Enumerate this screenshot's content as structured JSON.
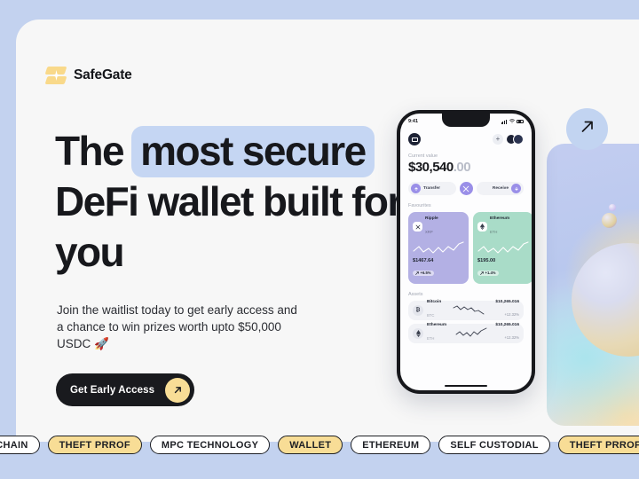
{
  "brand": {
    "name": "SafeGate",
    "logo_icon": "sparkle-stack-icon",
    "logo_color": "#f9d98a"
  },
  "hero": {
    "headline_part1": "The ",
    "headline_highlight": "most secure",
    "headline_part2": " DeFi wallet built for you",
    "highlight_color": "#c5d6f3",
    "subtext": "Join the waitlist today to get early access and a chance to win prizes worth upto $50,000 USDC 🚀",
    "cta_label": "Get Early Access",
    "cta_icon": "arrow-up-right-icon",
    "cta_bg": "#191a1e",
    "cta_icon_bg": "#f8dd96"
  },
  "badge": {
    "icon": "arrow-up-right-icon",
    "bg": "#c2d4f1"
  },
  "phone": {
    "status": {
      "time": "9:41",
      "signal_icon": "signal-bars-icon",
      "wifi_icon": "wifi-icon",
      "battery_icon": "battery-icon"
    },
    "topbar": {
      "menu_icon": "card-menu-icon",
      "add_icon": "plus-icon",
      "avatars_icon": "avatar-group-icon"
    },
    "balance": {
      "label": "Current value",
      "whole": "$30,540",
      "decimals": ".00"
    },
    "actions": [
      {
        "label": "Transfer",
        "icon": "arrow-up-icon"
      },
      {
        "label": "",
        "icon": "swap-icon"
      },
      {
        "label": "Receive",
        "icon": "arrow-down-icon"
      }
    ],
    "favourites_label": "Favourites",
    "favourites": [
      {
        "name": "Ripple",
        "symbol": "XRP",
        "value": "$1467.64",
        "change": "+6.5%",
        "icon": "xrp-icon",
        "bg": "#b3b0e4"
      },
      {
        "name": "Ethereum",
        "symbol": "ETH",
        "value": "$195.00",
        "change": "+1.4%",
        "icon": "eth-icon",
        "bg": "#a9dcc8"
      }
    ],
    "assets_label": "Assets",
    "assets": [
      {
        "name": "Bitcoin",
        "symbol": "BTC",
        "value": "$10,265.016",
        "change": "+12.32%",
        "icon": "btc-icon"
      },
      {
        "name": "Ethereum",
        "symbol": "ETH",
        "value": "$10,265.016",
        "change": "+12.32%",
        "icon": "eth-icon"
      }
    ]
  },
  "tags": [
    {
      "label": "MULTICHAIN",
      "highlight": false
    },
    {
      "label": "THEFT PRROF",
      "highlight": true
    },
    {
      "label": "MPC TECHNOLOGY",
      "highlight": false
    },
    {
      "label": "WALLET",
      "highlight": true
    },
    {
      "label": "ETHEREUM",
      "highlight": false
    },
    {
      "label": "SELF CUSTODIAL",
      "highlight": false
    },
    {
      "label": "THEFT PRROF",
      "highlight": true
    }
  ]
}
